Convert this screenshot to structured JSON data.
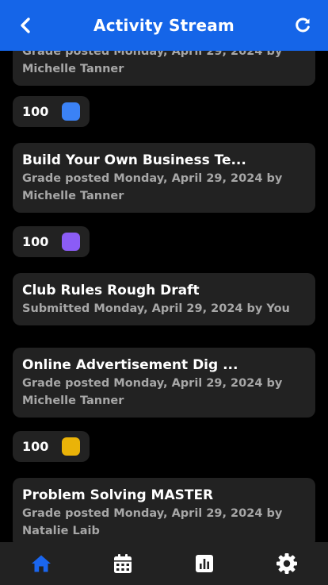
{
  "header": {
    "title": "Activity Stream",
    "back_icon": "back-chevron-icon",
    "refresh_icon": "refresh-icon"
  },
  "colors": {
    "header": "#1565e8",
    "card": "#222222",
    "muted_text": "#a7a7a7",
    "active_tab": "#1a66ef",
    "inactive_tab": "#ffffff"
  },
  "feed": [
    {
      "title": "",
      "subtitle": "Grade posted Monday, April 29, 2024 by Michelle Tanner",
      "score": "100",
      "swatch": "#3b82f6"
    },
    {
      "title": "Build Your Own Business Te...",
      "subtitle": "Grade posted Monday, April 29, 2024 by Michelle Tanner",
      "score": "100",
      "swatch": "#8b5cf6"
    },
    {
      "title": "Club Rules Rough Draft",
      "subtitle": "Submitted Monday, April 29, 2024 by You"
    },
    {
      "title": "Online Advertisement Dig ...",
      "subtitle": "Grade posted Monday, April 29, 2024 by Michelle Tanner",
      "score": "100",
      "swatch": "#eab308"
    },
    {
      "title": "Problem Solving MASTER",
      "subtitle": "Grade posted Monday, April 29, 2024 by Natalie Laib"
    }
  ],
  "tabs": [
    {
      "icon": "home-icon",
      "active": true
    },
    {
      "icon": "calendar-icon",
      "active": false
    },
    {
      "icon": "bar-chart-icon",
      "active": false
    },
    {
      "icon": "gear-icon",
      "active": false
    }
  ]
}
